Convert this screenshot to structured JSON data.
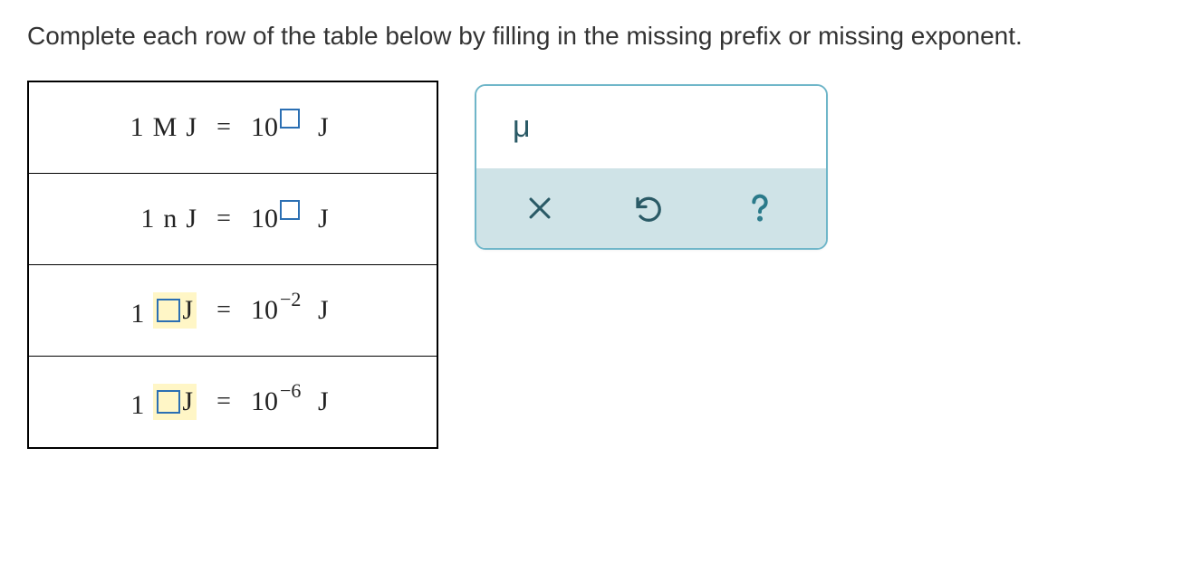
{
  "instruction": "Complete each row of the table below by filling in the missing prefix or missing exponent.",
  "rows": [
    {
      "one": "1",
      "prefix": "M",
      "unitL": "J",
      "eq": "=",
      "base": "10",
      "exp": "",
      "expBox": true,
      "unitR": "J",
      "prefixBox": false
    },
    {
      "one": "1",
      "prefix": "n",
      "unitL": "J",
      "eq": "=",
      "base": "10",
      "exp": "",
      "expBox": true,
      "unitR": "J",
      "prefixBox": false
    },
    {
      "one": "1",
      "prefix": "",
      "unitL": "J",
      "eq": "=",
      "base": "10",
      "exp": "−2",
      "expBox": false,
      "unitR": "J",
      "prefixBox": true
    },
    {
      "one": "1",
      "prefix": "",
      "unitL": "J",
      "eq": "=",
      "base": "10",
      "exp": "−6",
      "expBox": false,
      "unitR": "J",
      "prefixBox": true
    }
  ],
  "tools": {
    "mu": "μ",
    "clear_title": "Clear",
    "undo_title": "Undo",
    "help_title": "Help"
  }
}
